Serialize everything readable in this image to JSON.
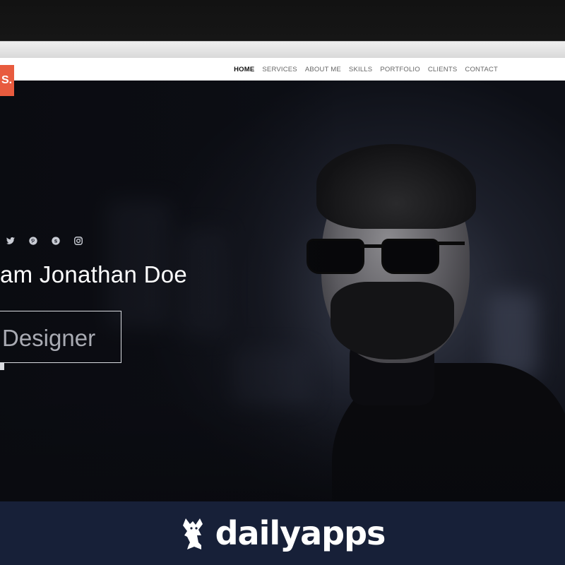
{
  "brand": {
    "badge_text": "S."
  },
  "nav": {
    "items": [
      {
        "label": "HOME",
        "active": true
      },
      {
        "label": "SERVICES",
        "active": false
      },
      {
        "label": "ABOUT ME",
        "active": false
      },
      {
        "label": "SKILLS",
        "active": false
      },
      {
        "label": "PORTFOLIO",
        "active": false
      },
      {
        "label": "CLIENTS",
        "active": false
      },
      {
        "label": "CONTACT",
        "active": false
      }
    ]
  },
  "hero": {
    "name_line": "am Jonathan Doe",
    "role": "Designer",
    "social_icons": [
      "twitter-icon",
      "pinterest-icon",
      "skype-icon",
      "instagram-icon"
    ]
  },
  "footer": {
    "logo_text": "dailyapps"
  },
  "colors": {
    "accent": "#e85b3e",
    "footer_bg": "#172038",
    "hero_bg": "#1c1f2a",
    "nav_active": "#111111"
  }
}
